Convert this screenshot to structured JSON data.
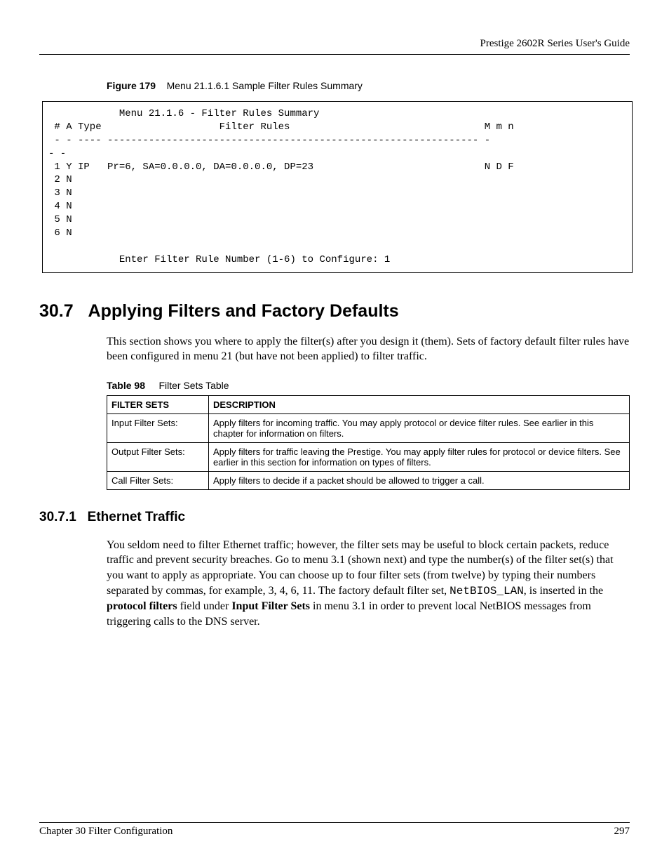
{
  "header": {
    "running_head": "Prestige 2602R Series User's Guide"
  },
  "figure": {
    "label": "Figure 179",
    "title": "Menu 21.1.6.1 Sample Filter Rules Summary",
    "screen": "            Menu 21.1.6 - Filter Rules Summary\n # A Type                    Filter Rules                                 M m n\n - - ---- --------------------------------------------------------------- -\n- -\n 1 Y IP   Pr=6, SA=0.0.0.0, DA=0.0.0.0, DP=23                             N D F\n 2 N\n 3 N\n 4 N\n 5 N\n 6 N\n\n            Enter Filter Rule Number (1-6) to Configure: 1"
  },
  "sections": {
    "s307": {
      "number": "30.7",
      "title": "Applying Filters and Factory Defaults",
      "body": "This section shows you where to apply the filter(s) after you design it (them). Sets of factory default filter rules have been configured in menu 21 (but have not been applied) to filter traffic."
    },
    "s3071": {
      "number": "30.7.1",
      "title": "Ethernet Traffic",
      "body_part1": "You seldom need to filter Ethernet traffic; however, the filter sets may be useful to block certain packets, reduce traffic and prevent security breaches. Go to menu 3.1 (shown next) and type the number(s) of the filter set(s) that you want to apply as appropriate. You can choose up to four filter sets (from twelve) by typing their numbers separated by commas, for example, 3, 4, 6, 11. The factory default filter set, ",
      "body_mono": "NetBIOS_LAN",
      "body_part2": ", is inserted in the ",
      "body_bold1": "protocol filters",
      "body_part3": " field under ",
      "body_bold2": "Input Filter Sets",
      "body_part4": " in menu 3.1 in order to prevent local NetBIOS messages from triggering calls to the DNS server."
    }
  },
  "table98": {
    "label": "Table 98",
    "title": "Filter Sets Table",
    "headers": {
      "c1": "FILTER SETS",
      "c2": "DESCRIPTION"
    },
    "rows": [
      {
        "name": "Input Filter Sets:",
        "desc": "Apply filters for incoming traffic. You may apply protocol or device filter rules. See earlier in this chapter for information on filters."
      },
      {
        "name": "Output Filter Sets:",
        "desc": "Apply filters for traffic leaving the Prestige. You may apply filter rules for protocol or device filters. See earlier in this section for information on types of filters."
      },
      {
        "name": "Call Filter Sets:",
        "desc": "Apply filters to decide if a packet should be allowed to trigger a call."
      }
    ]
  },
  "footer": {
    "chapter": "Chapter 30 Filter Configuration",
    "page": "297"
  }
}
